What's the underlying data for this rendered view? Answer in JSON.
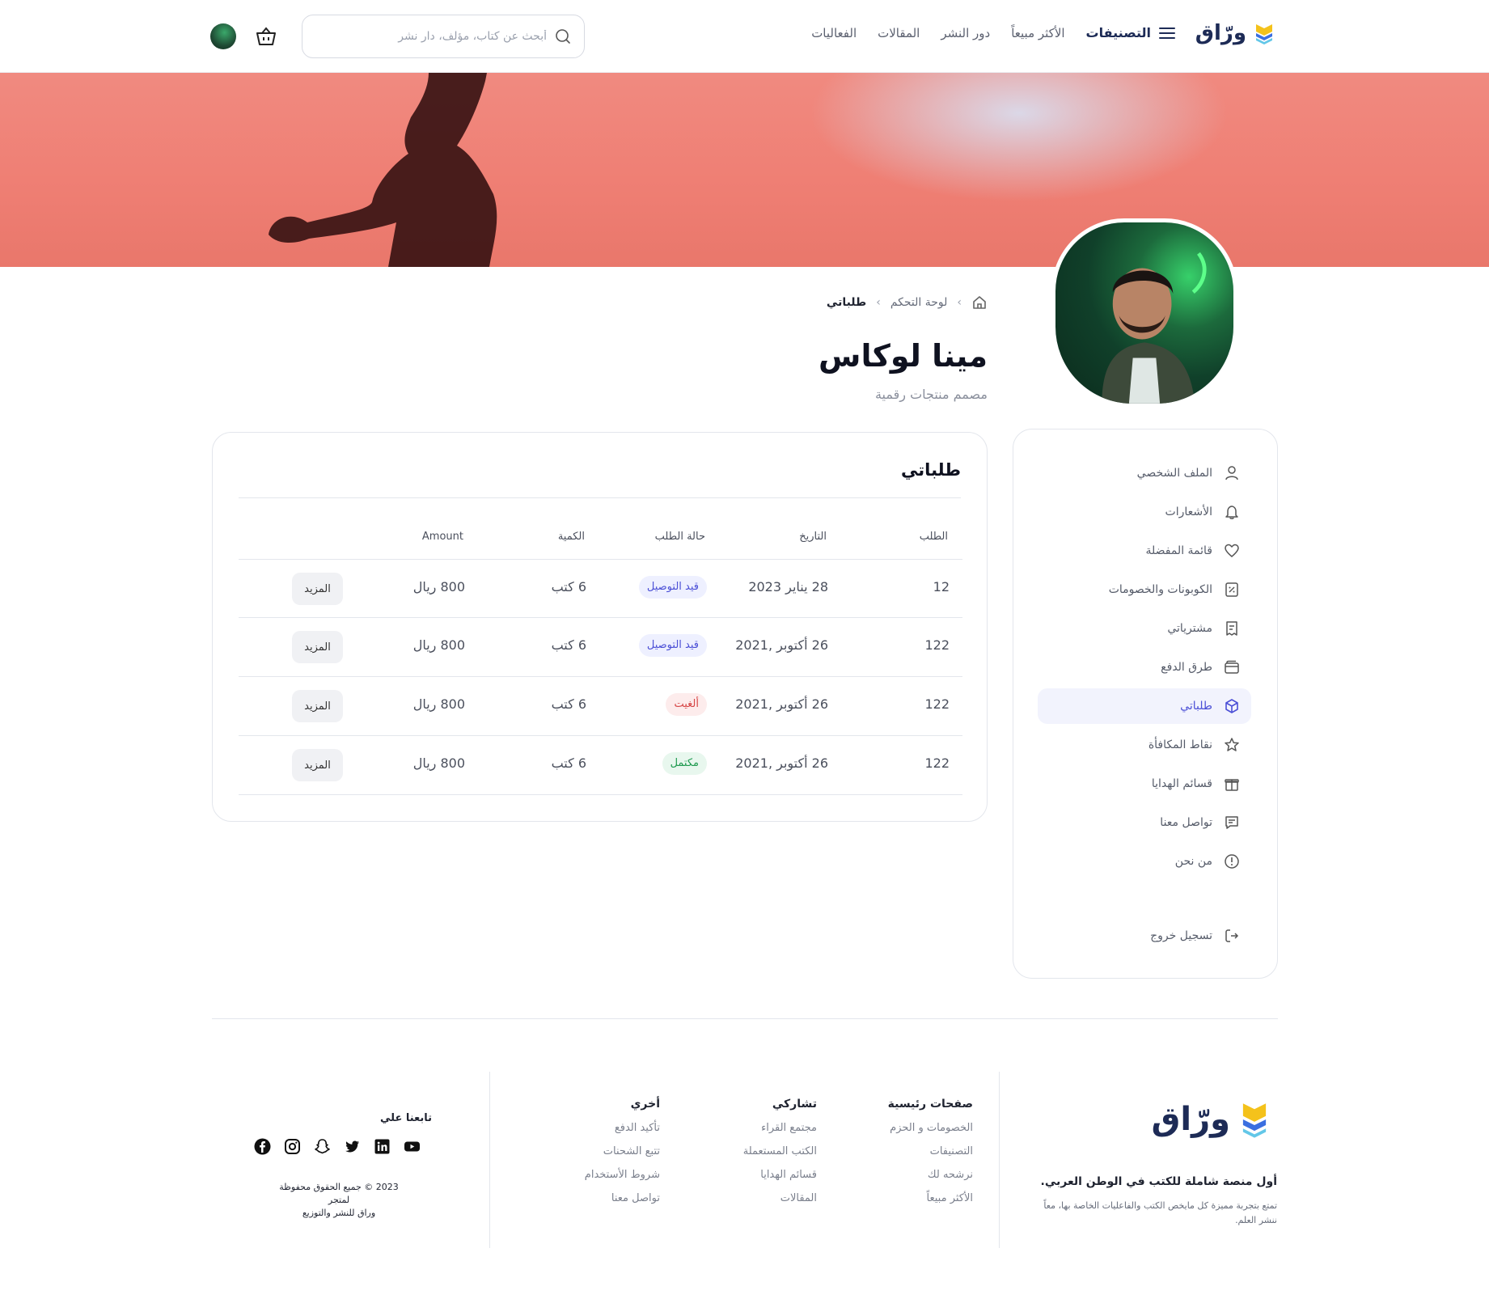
{
  "header": {
    "logo_text": "ورّاق",
    "nav": {
      "categories": "التصنيفات",
      "best_sellers": "الأكثر مبيعاً",
      "publishers": "دور النشر",
      "articles": "المقالات",
      "events": "الفعاليات"
    },
    "search_placeholder": "أبحث عن كتاب، مؤلف، دار نشر"
  },
  "breadcrumb": {
    "dashboard": "لوحة التحكم",
    "current": "طلباتي"
  },
  "profile": {
    "name": "مينا لوكاس",
    "role": "مصمم منتجات رقمية"
  },
  "sidebar": {
    "items": [
      {
        "label": "الملف الشخصي",
        "icon": "user-icon"
      },
      {
        "label": "الأشعارات",
        "icon": "bell-icon"
      },
      {
        "label": "قائمة المفضلة",
        "icon": "heart-icon"
      },
      {
        "label": "الكوبونات والخصومات",
        "icon": "coupon-icon"
      },
      {
        "label": "مشترياتي",
        "icon": "receipt-icon"
      },
      {
        "label": "طرق الدفع",
        "icon": "wallet-icon"
      },
      {
        "label": "طلباتي",
        "icon": "box-icon",
        "active": true
      },
      {
        "label": "نقاط المكافأة",
        "icon": "star-icon"
      },
      {
        "label": "قسائم الهدايا",
        "icon": "gift-icon"
      },
      {
        "label": "تواصل معنا",
        "icon": "message-icon"
      },
      {
        "label": "من نحن",
        "icon": "info-icon"
      }
    ],
    "logout": "تسجيل خروج"
  },
  "orders": {
    "title": "طلباتي",
    "columns": {
      "id": "الطلب",
      "date": "التاريخ",
      "status": "حالة الطلب",
      "qty": "الكمية",
      "amount": "Amount"
    },
    "rows": [
      {
        "id": "12",
        "date": "28 يناير 2023",
        "status": "قيد التوصيل",
        "status_kind": "blue",
        "qty": "6 كتب",
        "amount": "800 ريال",
        "action": "المزيد"
      },
      {
        "id": "122",
        "date": "26 أكتوبر ,2021",
        "status": "قيد التوصيل",
        "status_kind": "blue",
        "qty": "6 كتب",
        "amount": "800 ريال",
        "action": "المزيد"
      },
      {
        "id": "122",
        "date": "26 أكتوبر ,2021",
        "status": "ألغيت",
        "status_kind": "red",
        "qty": "6 كتب",
        "amount": "800 ريال",
        "action": "المزيد"
      },
      {
        "id": "122",
        "date": "26 أكتوبر ,2021",
        "status": "مكتمل",
        "status_kind": "green",
        "qty": "6 كتب",
        "amount": "800 ريال",
        "action": "المزيد"
      }
    ]
  },
  "footer": {
    "logo_text": "ورّاق",
    "tagline": "أول منصة شاملة للكتب في الوطن العربي.",
    "description": "تمتع بتجربة مميزة كل مايخص الكتب والفاعليات الخاصة بها، معاً ننشر العلم.",
    "col_main": {
      "title": "صفحات رئيسية",
      "links": [
        "الخصومات و الحزم",
        "التصنيفات",
        "نرشحه لك",
        "الأكثر مبيعاً"
      ]
    },
    "col_share": {
      "title": "تشاركي",
      "links": [
        "مجتمع القراء",
        "الكتب المستعملة",
        "قسائم الهدايا",
        "المقالات"
      ]
    },
    "col_other": {
      "title": "أخري",
      "links": [
        "تأكيد الدفع",
        "تتبع الشحنات",
        "شروط الأستخدام",
        "تواصل معنا"
      ]
    },
    "follow": "تابعنا علي",
    "copyright_1": "2023 © جميع الحقوق محفوظة لمتجر",
    "copyright_2": "وراق للنشر والتوزيع"
  },
  "colors": {
    "accent": "#4b4fd6",
    "brand_dark": "#1d2b56",
    "brand_yellow": "#f4c21b",
    "banner": "#ef7f74"
  }
}
